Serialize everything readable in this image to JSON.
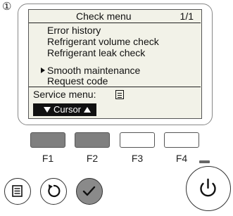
{
  "step_marker": "①",
  "lcd": {
    "title": "Check menu",
    "page": "1/1",
    "menu_items": [
      "Error history",
      "Refrigerant volume check",
      "Refrigerant leak check",
      "Smooth maintenance",
      "Request code"
    ],
    "selected_item": "Smooth maintenance",
    "service_menu_label": "Service menu:",
    "cursor_label": "Cursor"
  },
  "function_keys": [
    {
      "label": "F1",
      "state": "pressed"
    },
    {
      "label": "F2",
      "state": "pressed"
    },
    {
      "label": "F3",
      "state": "released"
    },
    {
      "label": "F4",
      "state": "released"
    }
  ],
  "buttons": {
    "menu_icon": "menu-icon",
    "return_icon": "return-arrow-icon",
    "select_icon": "checkmark-icon",
    "power_icon": "power-icon"
  },
  "colors": {
    "lcd_background": "#f2f2e8",
    "key_pressed": "#7f7f7f",
    "select_button": "#8a8a8a"
  }
}
